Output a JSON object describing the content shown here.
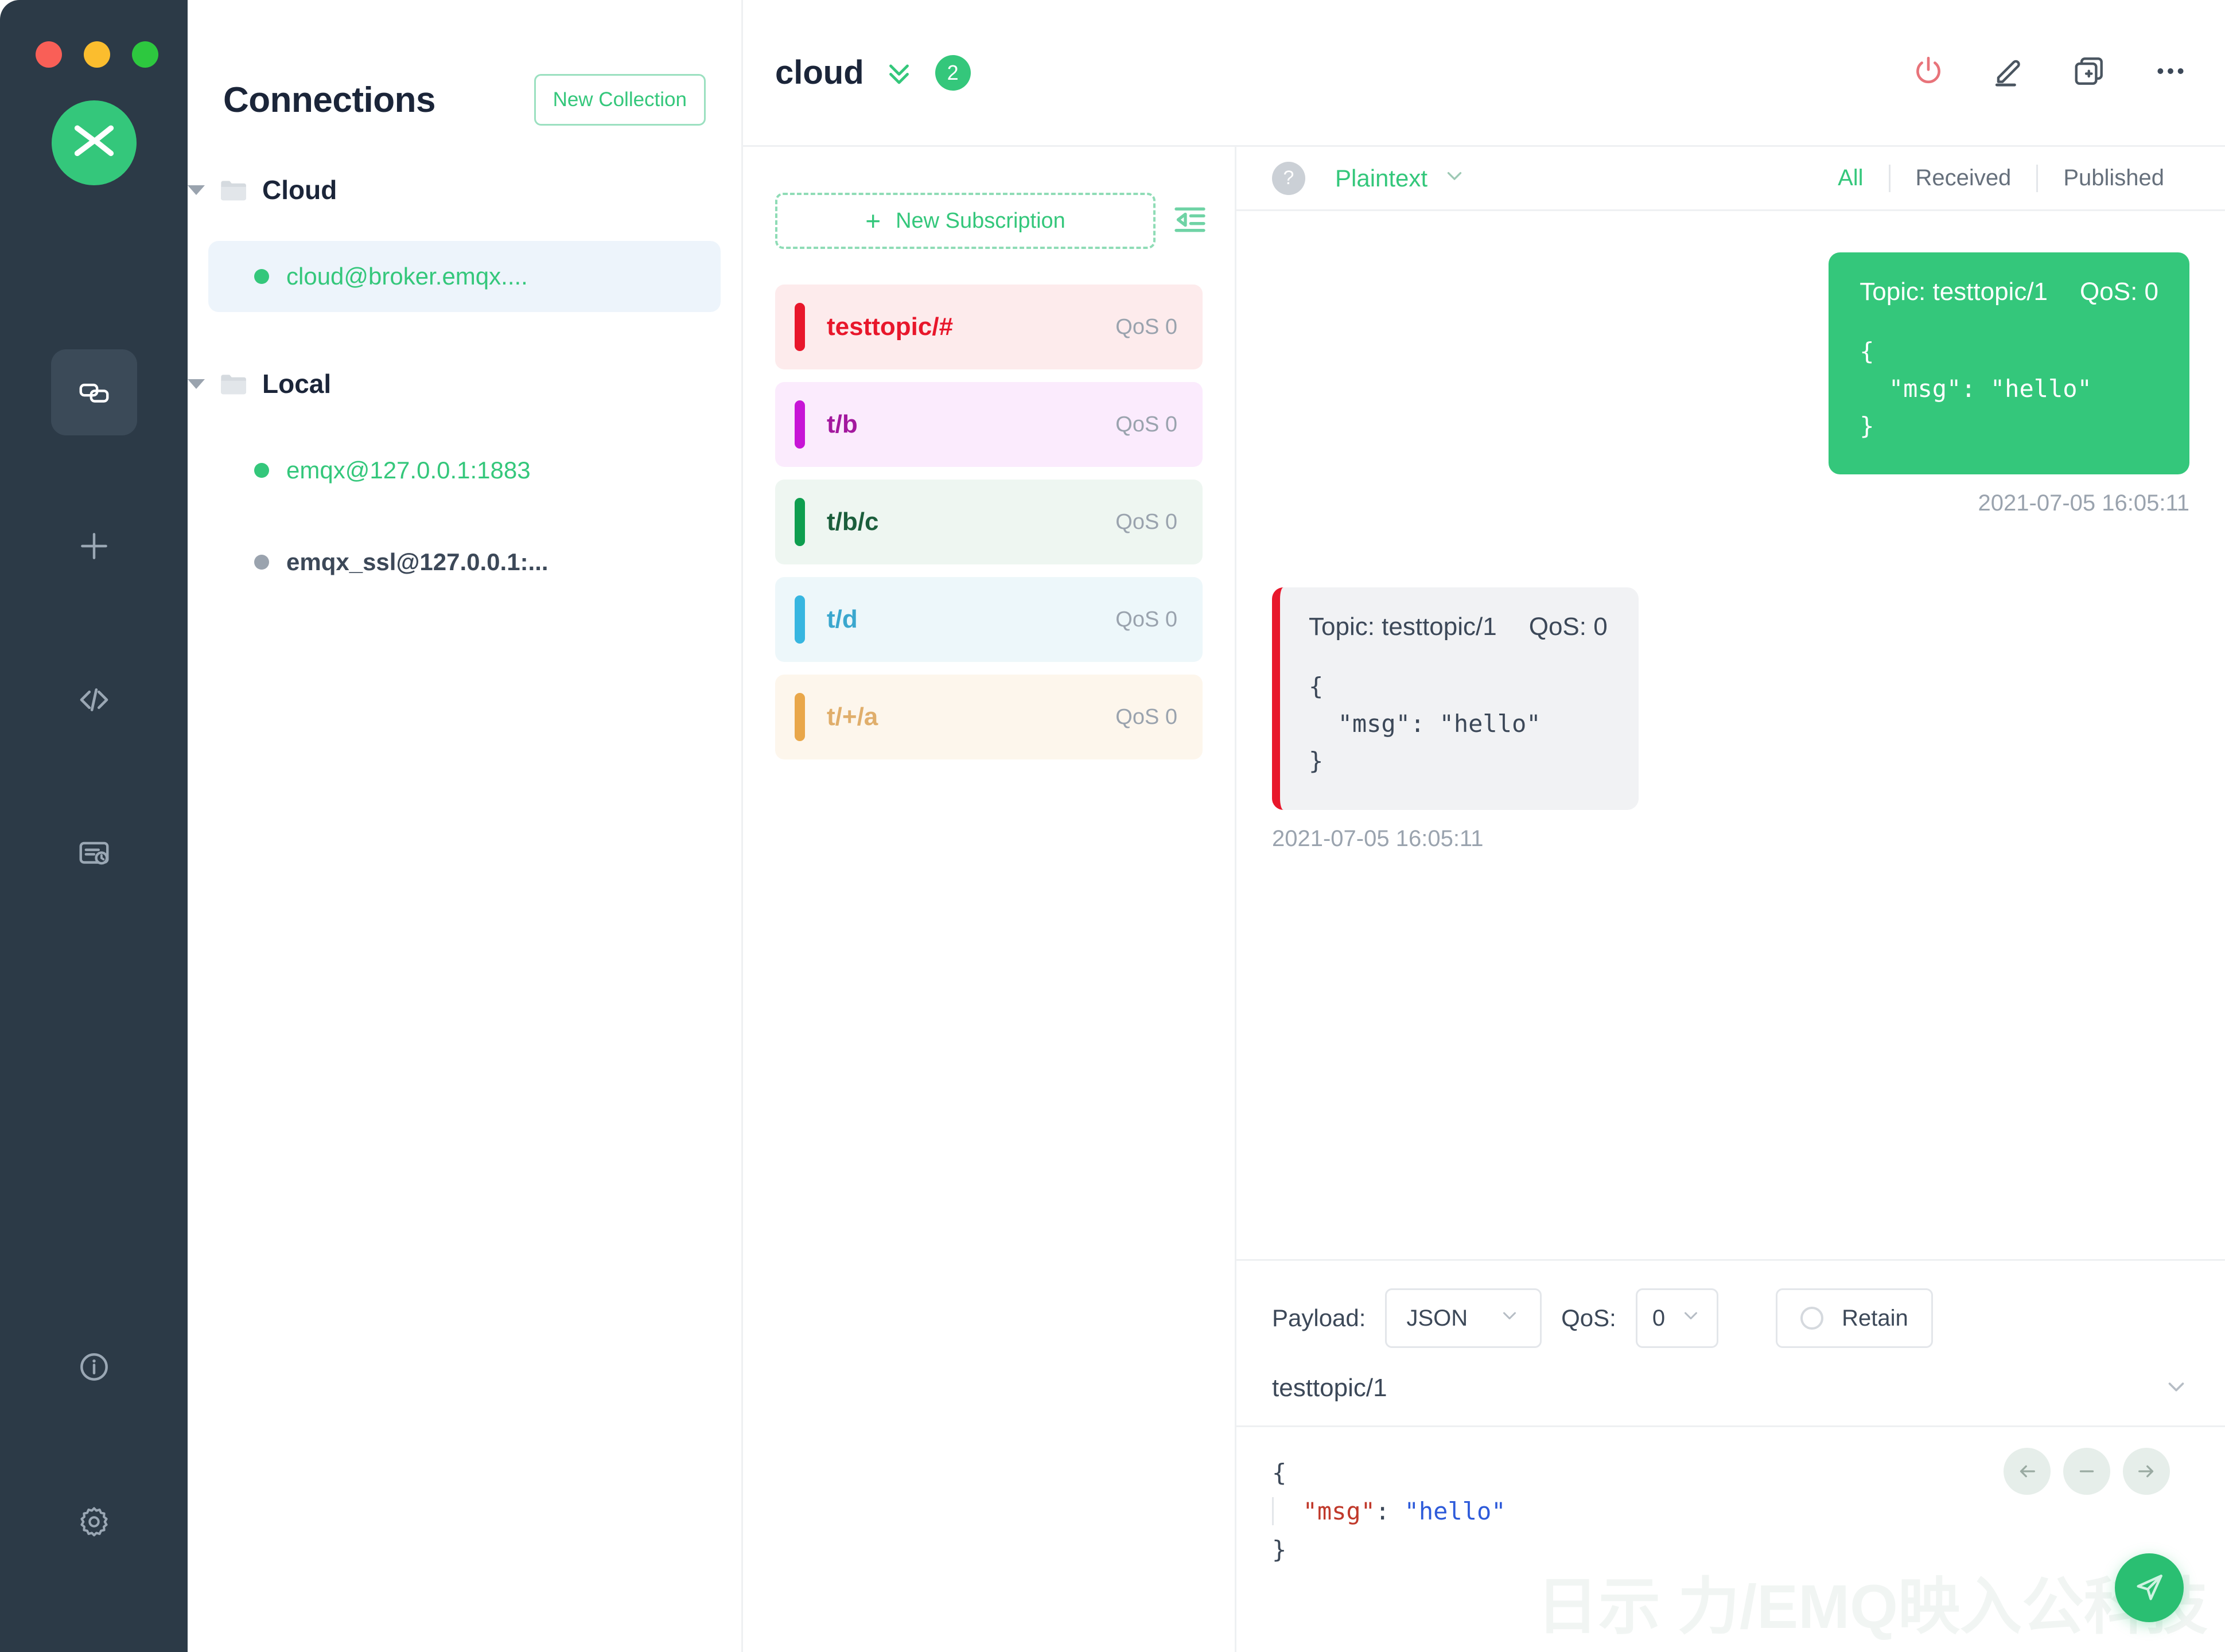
{
  "window": {
    "traffic_lights": [
      "close",
      "minimize",
      "maximize"
    ],
    "logo_name": "emqx-logo"
  },
  "rail": {
    "items": [
      {
        "icon": "connections-link-icon",
        "name": "connections",
        "active": true
      },
      {
        "icon": "plus-icon",
        "name": "new-connection",
        "active": false
      },
      {
        "icon": "code-icon",
        "name": "scripts",
        "active": false
      },
      {
        "icon": "log-history-icon",
        "name": "log",
        "active": false
      }
    ],
    "bottom_items": [
      {
        "icon": "info-icon",
        "name": "about",
        "active": false
      },
      {
        "icon": "gear-icon",
        "name": "settings",
        "active": false
      }
    ]
  },
  "connections": {
    "title": "Connections",
    "new_collection_label": "New Collection",
    "tree": [
      {
        "folder": "Cloud",
        "expanded": true,
        "items": [
          {
            "name": "cloud@broker.emqx....",
            "status": "connected",
            "selected": true
          }
        ]
      },
      {
        "folder": "Local",
        "expanded": true,
        "items": [
          {
            "name": "emqx@127.0.0.1:1883",
            "status": "connected",
            "selected": false
          },
          {
            "name": "emqx_ssl@127.0.0.1:...",
            "status": "disconnected",
            "selected": false
          }
        ]
      }
    ]
  },
  "topbar": {
    "title": "cloud",
    "chevron_icon": "double-chevron-down-icon",
    "badge": "2",
    "icons": [
      {
        "name": "power-icon",
        "color": "#E8737A"
      },
      {
        "name": "edit-pencil-icon",
        "color": "#4A5560"
      },
      {
        "name": "new-window-icon",
        "color": "#4A5560"
      },
      {
        "name": "more-horizontal-icon",
        "color": "#3C4858"
      }
    ]
  },
  "subscriptions": {
    "new_subscription_label": "New Subscription",
    "collapse_icon": "collapse-left-icon",
    "items": [
      {
        "topic": "testtopic/#",
        "qos": "QoS 0",
        "color": "#E8172B",
        "bg": "#FDEBEC",
        "text": "#E8172B"
      },
      {
        "topic": "t/b",
        "qos": "QoS 0",
        "color": "#C715D6",
        "bg": "#FBEBFD",
        "text": "#A3189E"
      },
      {
        "topic": "t/b/c",
        "qos": "QoS 0",
        "color": "#0E9E4F",
        "bg": "#EEF6F1",
        "text": "#1B5E3C"
      },
      {
        "topic": "t/d",
        "qos": "QoS 0",
        "color": "#37B6E0",
        "bg": "#EDF7FA",
        "text": "#3AA7CE"
      },
      {
        "topic": "t/+/a",
        "qos": "QoS 0",
        "color": "#E9A74A",
        "bg": "#FDF6EC",
        "text": "#E0AE6B"
      }
    ]
  },
  "messages_bar": {
    "help_icon": "question-mark-icon",
    "format": "Plaintext",
    "format_chevron": "chevron-down-icon",
    "filters": [
      {
        "label": "All",
        "active": true
      },
      {
        "label": "Received",
        "active": false
      },
      {
        "label": "Published",
        "active": false
      }
    ]
  },
  "messages": [
    {
      "direction": "published",
      "topic_label": "Topic: testtopic/1",
      "qos_label": "QoS: 0",
      "payload": "{\n  \"msg\": \"hello\"\n}",
      "time": "2021-07-05 16:05:11"
    },
    {
      "direction": "received",
      "topic_label": "Topic: testtopic/1",
      "qos_label": "QoS: 0",
      "payload": "{\n  \"msg\": \"hello\"\n}",
      "time": "2021-07-05 16:05:11"
    }
  ],
  "publish": {
    "payload_label": "Payload:",
    "payload_format": "JSON",
    "qos_label": "QoS:",
    "qos_value": "0",
    "retain_label": "Retain",
    "retain_checked": false,
    "topic_value": "testtopic/1",
    "topic_chevron": "chevron-down-icon",
    "editor": {
      "line1": "{",
      "key": "\"msg\"",
      "colon": ": ",
      "value": "\"hello\"",
      "line3": "}"
    },
    "nav_buttons": [
      {
        "icon": "arrow-left-icon"
      },
      {
        "icon": "minus-icon"
      },
      {
        "icon": "arrow-right-icon"
      }
    ],
    "send_icon": "send-paper-plane-icon"
  },
  "watermark": "日示 力/EMQ映入公科技",
  "colors": {
    "brand_green": "#34C77B",
    "rail_dark": "#2C3A47",
    "received_red": "#E8172B"
  }
}
